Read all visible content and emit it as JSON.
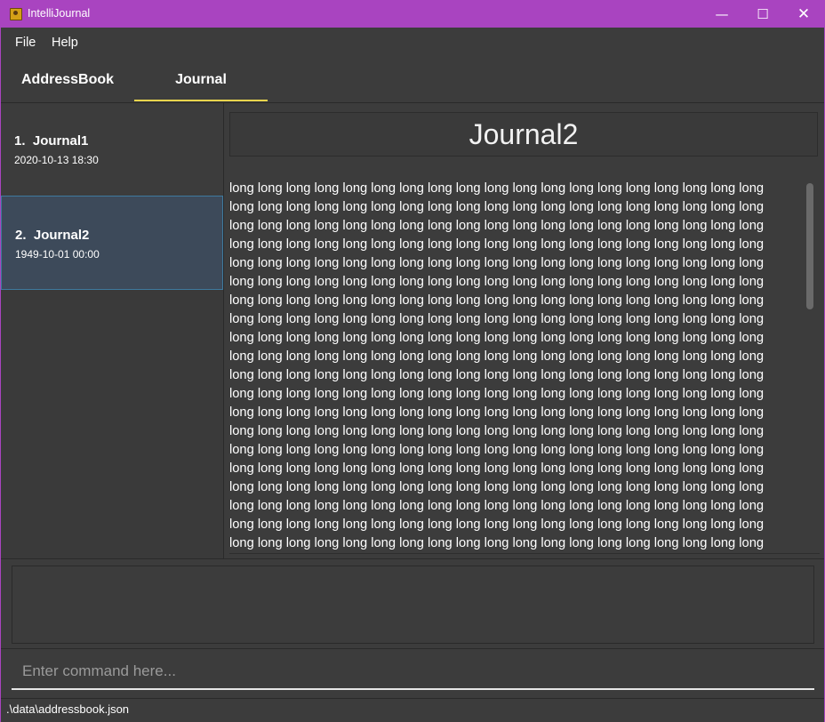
{
  "window": {
    "title": "IntelliJournal",
    "icon": "app-icon",
    "controls": {
      "minimize": "—",
      "maximize": "☐",
      "close": "✕"
    }
  },
  "menu": {
    "file": "File",
    "help": "Help"
  },
  "tabs": [
    {
      "label": "AddressBook",
      "selected": false
    },
    {
      "label": "Journal",
      "selected": true
    }
  ],
  "journal_list": [
    {
      "index": "1.",
      "title": "Journal1",
      "date": "2020-10-13 18:30",
      "selected": false
    },
    {
      "index": "2.",
      "title": "Journal2",
      "date": "1949-10-01 00:00",
      "selected": true
    }
  ],
  "detail": {
    "title": "Journal2",
    "body_word": "long",
    "body_lines_visible": 20,
    "words_per_line": 19
  },
  "result_display": "",
  "command": {
    "placeholder": "Enter command here...",
    "value": ""
  },
  "status": {
    "path": ".\\data\\addressbook.json"
  },
  "colors": {
    "titlebar": "#a944c0",
    "tab_indicator": "#e8d44d",
    "selected_card": "#3d4a5a",
    "background": "#3c3c3c"
  }
}
